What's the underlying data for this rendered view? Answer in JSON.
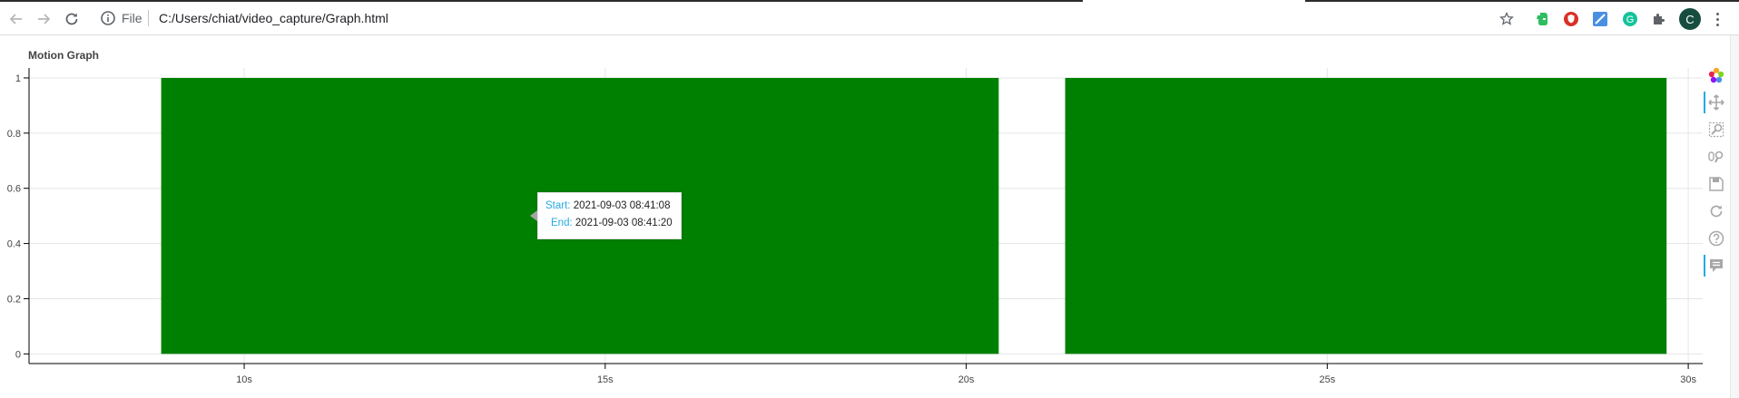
{
  "browser": {
    "back_icon": "back-arrow-icon",
    "forward_icon": "forward-arrow-icon",
    "reload_icon": "reload-icon",
    "info_icon": "info-icon",
    "scheme_label": "File",
    "url": "C:/Users/chiat/video_capture/Graph.html",
    "profile_initial": "C",
    "extensions": [
      "star-icon",
      "evernote-icon",
      "red-shield-icon",
      "blue-square-icon",
      "grammarly-icon",
      "puzzle-icon"
    ]
  },
  "plot_tools": [
    "bokeh-logo-icon",
    "pan-icon",
    "box-zoom-icon",
    "wheel-zoom-icon",
    "save-icon",
    "reset-icon",
    "help-icon",
    "hover-icon"
  ],
  "chart_data": {
    "type": "bar",
    "title": "Motion Graph",
    "xlabel": "",
    "ylabel": "",
    "x_unit": "s",
    "xlim": [
      7.02,
      30.2
    ],
    "ylim": [
      -0.035,
      1.036
    ],
    "x_ticks": [
      10,
      15,
      20,
      25,
      30
    ],
    "x_tick_labels": [
      "10s",
      "15s",
      "20s",
      "25s",
      "30s"
    ],
    "y_ticks": [
      0,
      0.2,
      0.4,
      0.6,
      0.8,
      1
    ],
    "y_tick_labels": [
      "0",
      "0.2",
      "0.4",
      "0.6",
      "0.8",
      "1"
    ],
    "grid": true,
    "bar_color": "#008000",
    "intervals": [
      {
        "start": 8.85,
        "end": 20.45,
        "value": 1
      },
      {
        "start": 21.37,
        "end": 29.7,
        "value": 1
      }
    ],
    "tooltip": {
      "start_label": "Start:",
      "start_value": "2021-09-03 08:41:08",
      "end_label": "End:",
      "end_value": "2021-09-03 08:41:20"
    }
  }
}
